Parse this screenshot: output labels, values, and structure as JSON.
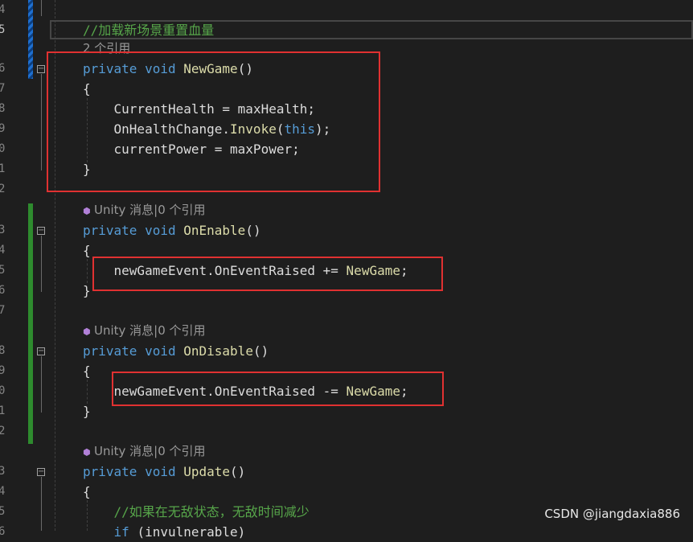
{
  "editor": {
    "current_line_number": "5",
    "line_numbers": [
      "4",
      "5",
      "6",
      "7",
      "8",
      "9",
      "0",
      "1",
      "2",
      "3",
      "4",
      "5",
      "6",
      "7",
      "8",
      "9",
      "0",
      "1",
      "2",
      "3",
      "4",
      "5",
      "6"
    ],
    "comment_load_scene": "//加载新场景重置血量",
    "codelens_new_game": "2 个引用",
    "codelens_unity": "Unity 消息|0 个引用",
    "kw_private": "private",
    "kw_void": "void",
    "kw_this": "this",
    "kw_if": "if",
    "fn_new_game": "NewGame",
    "fn_on_enable": "OnEnable",
    "fn_on_disable": "OnDisable",
    "fn_update": "Update",
    "fn_invoke": "Invoke",
    "id_current_health": "CurrentHealth",
    "id_max_health": "maxHealth",
    "id_on_health_change": "OnHealthChange",
    "id_current_power": "currentPower",
    "id_max_power": "maxPower",
    "id_new_game_event": "newGameEvent",
    "id_on_event_raised": "OnEventRaised",
    "op_add": "+=",
    "op_remove": "-=",
    "comment_invulnerable": "//如果在无敌状态，无敌时间减少",
    "partial_last_line": "(invulnerable)"
  },
  "watermark": {
    "text": "CSDN @jiangdaxia886"
  },
  "colors": {
    "keyword": "#569cd6",
    "function": "#dcdcaa",
    "comment": "#57a64a",
    "highlight_box": "#e03131",
    "change_bar_saved": "#2e8b2e",
    "change_bar_unsaved": "#1e6fd0"
  }
}
